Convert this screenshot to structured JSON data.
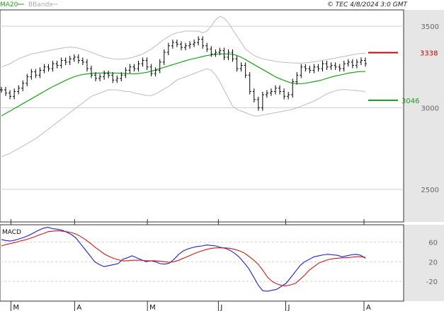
{
  "header": {
    "ma_label": "MA20",
    "bb_label": "BBands",
    "source": "© TEC 4/8/2024 3:0 GMT"
  },
  "colors": {
    "price": "#000000",
    "ma20": "#1aa51a",
    "bbands": "#bdbdbd",
    "grid": "#cfcfcf",
    "resistance": "#cc0000",
    "support": "#1a9a1a",
    "macd": "#1f1fd6",
    "signal": "#cc1a1a",
    "side_panel": "#e6e6e6"
  },
  "chart_data": [
    {
      "type": "line",
      "subtype": "ohlc-bars",
      "title": "",
      "y_tick_labels": [
        "3500",
        "3000",
        "2500"
      ],
      "y_ticks": [
        3500,
        3000,
        2500
      ],
      "ylim": [
        2300,
        3600
      ],
      "x_tick_labels": [
        "M",
        "A",
        "M",
        "J",
        "J",
        "A"
      ],
      "legend": [
        "MA20",
        "BBands"
      ],
      "levels": [
        {
          "name": "resistance",
          "label": "3338",
          "value": 3338
        },
        {
          "name": "support",
          "label": "3046",
          "value": 3046
        }
      ],
      "series": [
        {
          "name": "Price",
          "values": [
            3110,
            3090,
            3070,
            3100,
            3120,
            3150,
            3190,
            3220,
            3200,
            3230,
            3250,
            3240,
            3270,
            3260,
            3290,
            3280,
            3300,
            3310,
            3290,
            3280,
            3240,
            3200,
            3180,
            3190,
            3210,
            3200,
            3170,
            3180,
            3200,
            3230,
            3250,
            3240,
            3270,
            3290,
            3250,
            3210,
            3230,
            3280,
            3340,
            3380,
            3400,
            3390,
            3370,
            3380,
            3390,
            3400,
            3420,
            3380,
            3360,
            3330,
            3340,
            3350,
            3310,
            3340,
            3300,
            3240,
            3260,
            3200,
            3100,
            3050,
            3000,
            3080,
            3090,
            3100,
            3120,
            3100,
            3070,
            3080,
            3160,
            3200,
            3250,
            3240,
            3230,
            3250,
            3240,
            3270,
            3250,
            3260,
            3250,
            3240,
            3270,
            3280,
            3260,
            3280,
            3290,
            3270
          ]
        },
        {
          "name": "MA20",
          "values": [
            2950,
            2965,
            2980,
            2995,
            3010,
            3025,
            3040,
            3055,
            3070,
            3085,
            3100,
            3115,
            3130,
            3142,
            3155,
            3168,
            3180,
            3190,
            3198,
            3204,
            3208,
            3210,
            3212,
            3213,
            3214,
            3214,
            3213,
            3212,
            3211,
            3210,
            3209,
            3208,
            3210,
            3213,
            3218,
            3224,
            3232,
            3240,
            3248,
            3256,
            3264,
            3272,
            3280,
            3288,
            3296,
            3302,
            3308,
            3314,
            3320,
            3324,
            3328,
            3330,
            3330,
            3330,
            3328,
            3320,
            3310,
            3295,
            3280,
            3265,
            3250,
            3235,
            3220,
            3205,
            3190,
            3178,
            3168,
            3158,
            3150,
            3148,
            3148,
            3150,
            3155,
            3160,
            3165,
            3172,
            3180,
            3188,
            3195,
            3200,
            3206,
            3212,
            3216,
            3220,
            3222,
            3222
          ]
        },
        {
          "name": "BBands upper",
          "values": [
            3250,
            3260,
            3270,
            3285,
            3300,
            3310,
            3320,
            3330,
            3335,
            3340,
            3345,
            3350,
            3355,
            3360,
            3365,
            3370,
            3372,
            3370,
            3365,
            3358,
            3350,
            3340,
            3330,
            3320,
            3310,
            3305,
            3300,
            3298,
            3298,
            3300,
            3305,
            3312,
            3320,
            3330,
            3345,
            3360,
            3380,
            3400,
            3420,
            3435,
            3450,
            3460,
            3465,
            3470,
            3470,
            3470,
            3470,
            3460,
            3470,
            3500,
            3540,
            3560,
            3550,
            3520,
            3480,
            3440,
            3400,
            3360,
            3340,
            3320,
            3310,
            3300,
            3295,
            3290,
            3285,
            3280,
            3278,
            3276,
            3275,
            3274,
            3274,
            3276,
            3278,
            3282,
            3286,
            3290,
            3295,
            3300,
            3305,
            3310,
            3315,
            3320,
            3325,
            3330,
            3333,
            3335
          ]
        },
        {
          "name": "BBands lower",
          "values": [
            2700,
            2710,
            2720,
            2735,
            2750,
            2765,
            2780,
            2795,
            2810,
            2830,
            2850,
            2870,
            2890,
            2910,
            2930,
            2950,
            2970,
            2990,
            3010,
            3030,
            3050,
            3070,
            3080,
            3090,
            3100,
            3110,
            3110,
            3110,
            3105,
            3100,
            3100,
            3090,
            3085,
            3080,
            3075,
            3075,
            3085,
            3100,
            3115,
            3130,
            3150,
            3170,
            3180,
            3190,
            3200,
            3210,
            3220,
            3230,
            3240,
            3230,
            3200,
            3160,
            3110,
            3060,
            3010,
            2990,
            2980,
            2970,
            2960,
            2950,
            2950,
            2955,
            2960,
            2965,
            2970,
            2975,
            2980,
            2985,
            2990,
            3000,
            3010,
            3020,
            3030,
            3040,
            3055,
            3070,
            3085,
            3095,
            3105,
            3110,
            3112,
            3110,
            3108,
            3105,
            3102,
            3100
          ]
        }
      ]
    },
    {
      "type": "line",
      "title": "MACD",
      "y_tick_labels": [
        "60",
        "20",
        "-20"
      ],
      "y_ticks": [
        60,
        20,
        -20
      ],
      "ylim": [
        -60,
        95
      ],
      "x_tick_labels": [
        "M",
        "A",
        "M",
        "J",
        "J",
        "A"
      ],
      "series": [
        {
          "name": "MACD",
          "values": [
            65,
            63,
            62,
            64,
            67,
            70,
            74,
            79,
            84,
            88,
            90,
            87,
            86,
            84,
            80,
            75,
            68,
            56,
            44,
            32,
            20,
            14,
            10,
            12,
            14,
            16,
            25,
            28,
            32,
            28,
            24,
            20,
            22,
            20,
            16,
            15,
            17,
            25,
            35,
            42,
            46,
            49,
            51,
            52,
            54,
            53,
            52,
            49,
            47,
            43,
            37,
            29,
            18,
            6,
            -10,
            -27,
            -39,
            -40,
            -38,
            -36,
            -30,
            -24,
            -12,
            0,
            12,
            20,
            25,
            30,
            32,
            34,
            35,
            34,
            33,
            30,
            32,
            34,
            35,
            33,
            27
          ]
        },
        {
          "name": "Signal",
          "values": [
            52,
            55,
            57,
            59,
            62,
            64,
            67,
            70,
            74,
            77,
            81,
            82,
            83,
            82,
            81,
            79,
            76,
            71,
            65,
            58,
            50,
            43,
            36,
            31,
            27,
            24,
            22,
            22,
            23,
            23,
            23,
            22,
            22,
            22,
            21,
            20,
            19,
            20,
            23,
            27,
            31,
            35,
            39,
            42,
            45,
            47,
            48,
            48,
            48,
            47,
            45,
            42,
            38,
            31,
            24,
            15,
            3,
            -11,
            -20,
            -25,
            -28,
            -29,
            -27,
            -24,
            -16,
            -7,
            3,
            10,
            17,
            21,
            24,
            26,
            27,
            28,
            28,
            29,
            30,
            30,
            29
          ]
        }
      ]
    }
  ]
}
